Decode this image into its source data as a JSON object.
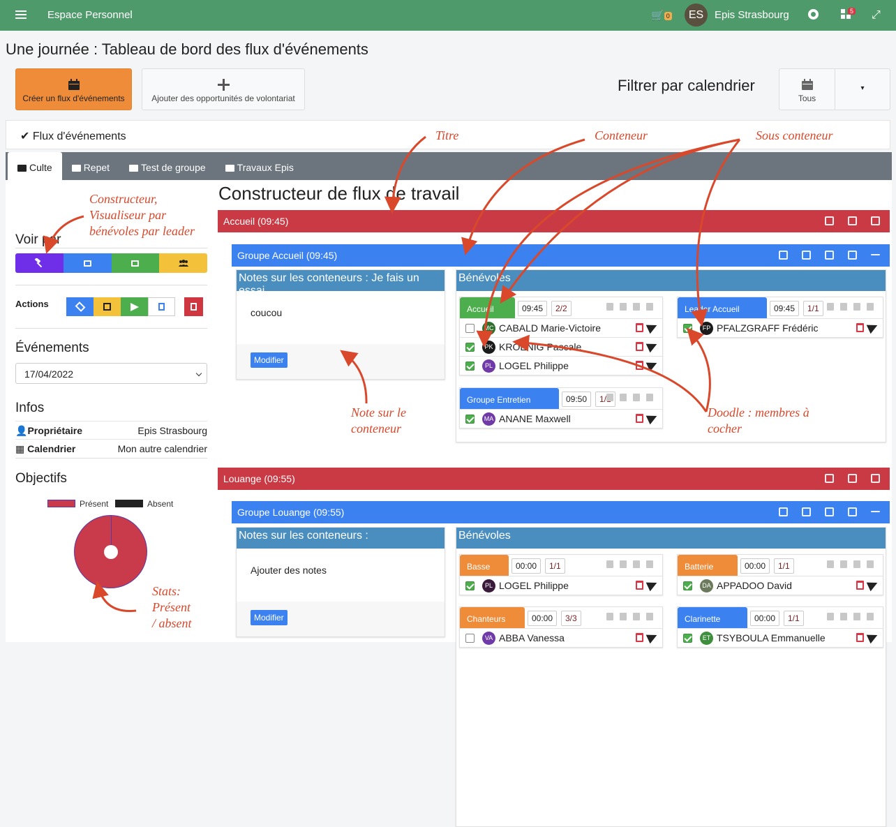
{
  "topbar": {
    "title": "Espace Personnel",
    "cart_count": "0",
    "avatar_initials": "ES",
    "user_name": "Epis Strasbourg",
    "apps_count": "5"
  },
  "page_title": "Une journée : Tableau de bord des flux d'événements",
  "buttons": {
    "create": "Créer un flux d'événements",
    "add": "Ajouter des opportunités de volontariat"
  },
  "filter": {
    "label": "Filtrer par calendrier",
    "all": "Tous"
  },
  "flux_header": "Flux d'événements",
  "tabs": [
    "Culte",
    "Repet",
    "Test de groupe",
    "Travaux Epis"
  ],
  "sidebar": {
    "voir_par": "Voir par",
    "actions": "Actions",
    "evenements": "Événements",
    "date": "17/04/2022",
    "infos": "Infos",
    "owner_label": "Propriétaire",
    "owner_value": "Epis Strasbourg",
    "calendar_label": "Calendrier",
    "calendar_value": "Mon autre calendrier",
    "objectifs": "Objectifs",
    "legend_present": "Présent",
    "legend_absent": "Absent"
  },
  "chart_data": {
    "type": "pie",
    "categories": [
      "Présent",
      "Absent"
    ],
    "values": [
      100,
      0
    ],
    "colors": [
      "#c93a4a",
      "#222222"
    ]
  },
  "main": {
    "title": "Constructeur de flux de travail",
    "sections": [
      {
        "header": "Accueil (09:45)",
        "group": "Groupe Accueil (09:45)",
        "notes_title": "Notes sur les conteneurs : Je fais un essai",
        "notes_body": "coucou",
        "modify": "Modifier",
        "volunteers": "Bénévoles",
        "subs": [
          {
            "name": "Accueil",
            "time": "09:45",
            "count": "2/2",
            "members": [
              {
                "initials": "MC",
                "name": "CABALD Marie-Victoire",
                "checked": false
              },
              {
                "initials": "PK",
                "name": "KROENIG Pascale",
                "checked": true
              },
              {
                "initials": "PL",
                "name": "LOGEL Philippe",
                "checked": true
              }
            ]
          },
          {
            "name": "Leader Accueil",
            "time": "09:45",
            "count": "1/1",
            "members": [
              {
                "initials": "FP",
                "name": "PFALZGRAFF Frédéric",
                "checked": true
              }
            ]
          },
          {
            "name": "Groupe Entretien",
            "time": "09:50",
            "count": "1/1",
            "members": [
              {
                "initials": "MA",
                "name": "ANANE Maxwell",
                "checked": true
              }
            ]
          }
        ]
      },
      {
        "header": "Louange (09:55)",
        "group": "Groupe Louange (09:55)",
        "notes_title": "Notes sur les conteneurs :",
        "notes_body": "Ajouter des notes",
        "modify": "Modifier",
        "volunteers": "Bénévoles",
        "subs": [
          {
            "name": "Basse",
            "time": "00:00",
            "count": "1/1",
            "members": [
              {
                "initials": "PL",
                "name": "LOGEL Philippe",
                "checked": true
              }
            ]
          },
          {
            "name": "Batterie",
            "time": "00:00",
            "count": "1/1",
            "members": [
              {
                "initials": "DA",
                "name": "APPADOO David",
                "checked": true
              }
            ]
          },
          {
            "name": "Chanteurs",
            "time": "00:00",
            "count": "3/3",
            "members": [
              {
                "initials": "VA",
                "name": "ABBA Vanessa",
                "checked": false
              }
            ]
          },
          {
            "name": "Clarinette",
            "time": "00:00",
            "count": "1/1",
            "members": [
              {
                "initials": "ET",
                "name": "TSYBOULA Emmanuelle",
                "checked": true
              }
            ]
          }
        ]
      }
    ]
  },
  "annotations": {
    "titre": "Titre",
    "conteneur": "Conteneur",
    "sous_conteneur": "Sous conteneur",
    "constructeur": "Constructeur,\nVisualiseur par\nbénévoles par leader",
    "note": "Note sur le\nconteneur",
    "doodle": "Doodle : membres à\ncocher",
    "stats": "Stats:\nPrésent\n/ absent"
  }
}
